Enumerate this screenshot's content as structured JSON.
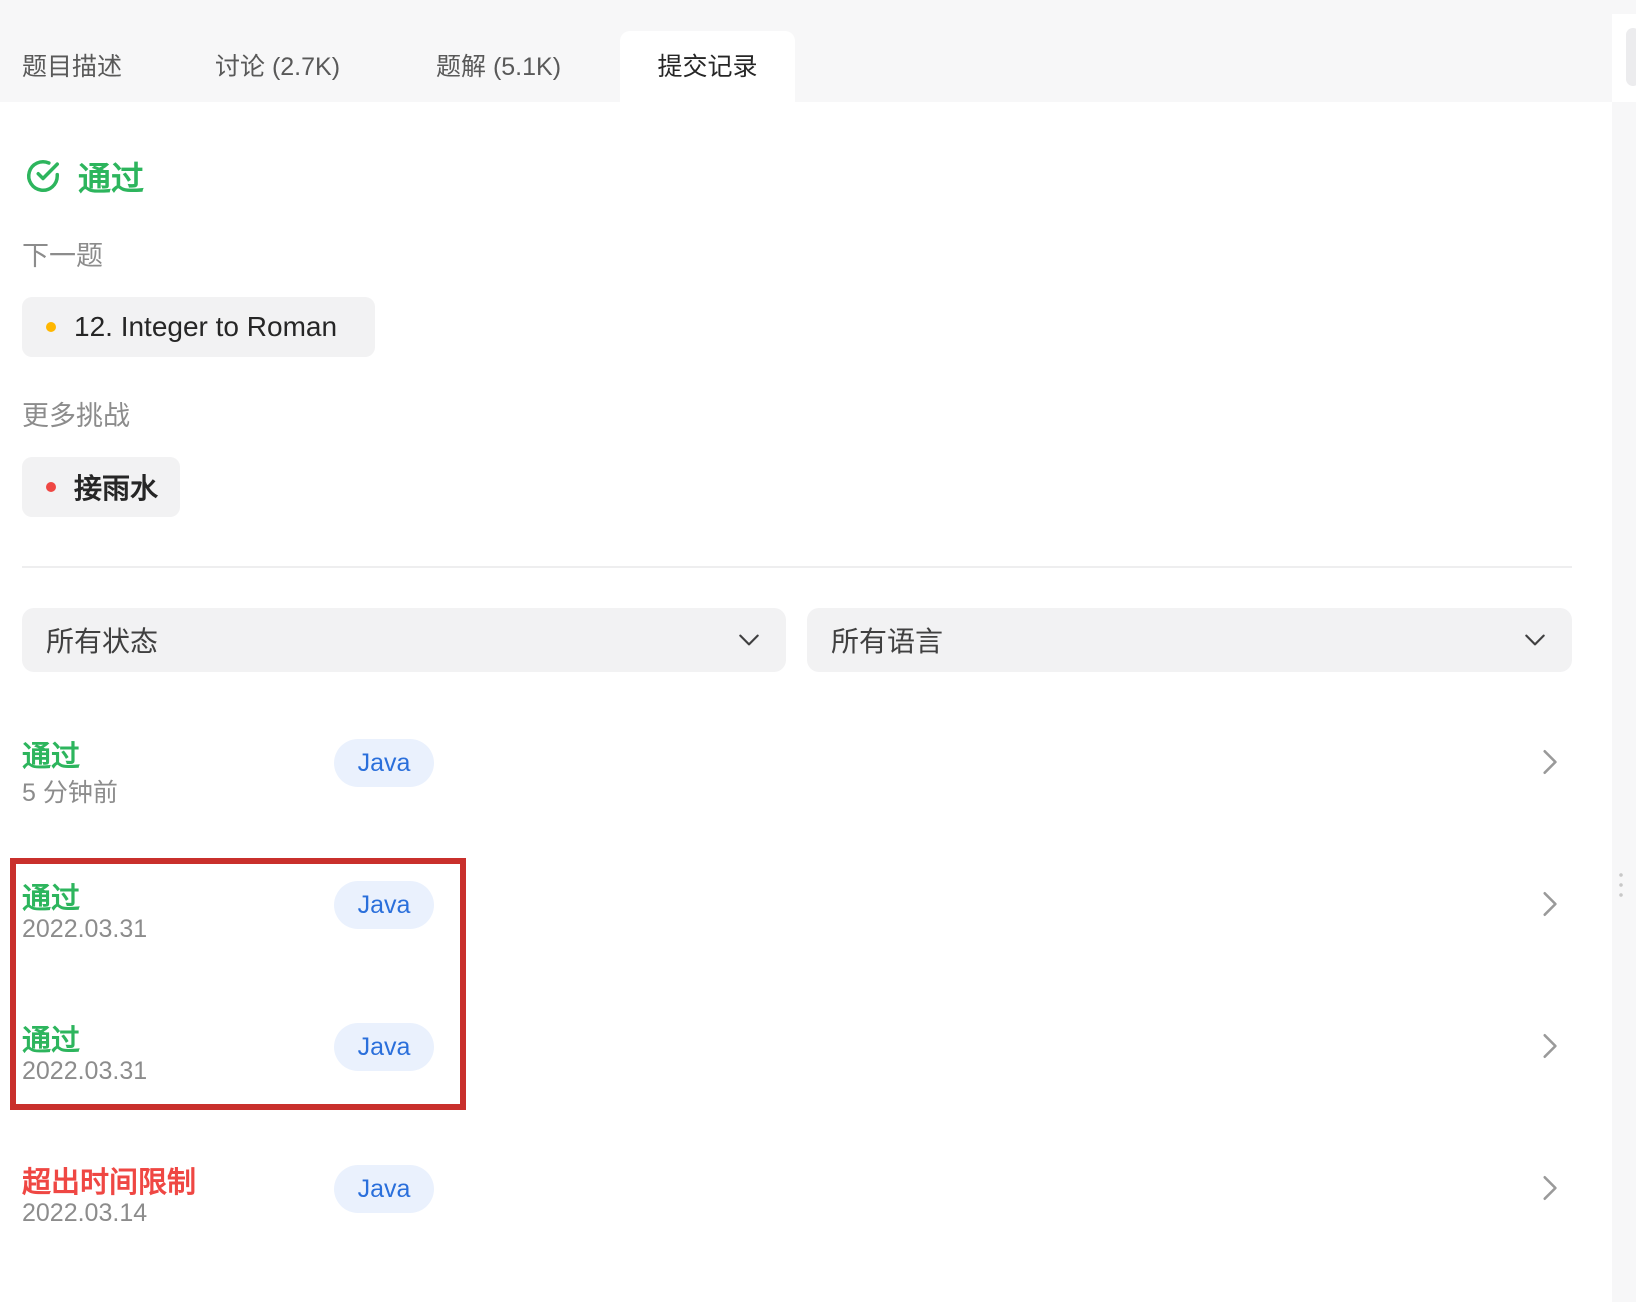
{
  "tabs": [
    {
      "label": "题目描述"
    },
    {
      "label": "讨论 (2.7K)"
    },
    {
      "label": "题解 (5.1K)"
    },
    {
      "label": "提交记录"
    }
  ],
  "status": {
    "label": "通过",
    "color": "#2db55d"
  },
  "next_problem": {
    "heading": "下一题",
    "title": "12. Integer to Roman",
    "difficulty_color": "#ffb700"
  },
  "more_challenges": {
    "heading": "更多挑战",
    "title": "接雨水",
    "difficulty_color": "#ef4743"
  },
  "filters": {
    "status": {
      "value": "所有状态"
    },
    "language": {
      "value": "所有语言"
    }
  },
  "submissions": [
    {
      "status": "通过",
      "time": "5 分钟前",
      "lang": "Java",
      "status_color": "#2db55d"
    },
    {
      "status": "通过",
      "time": "2022.03.31",
      "lang": "Java",
      "status_color": "#2db55d"
    },
    {
      "status": "通过",
      "time": "2022.03.31",
      "lang": "Java",
      "status_color": "#2db55d"
    },
    {
      "status": "超出时间限制",
      "time": "2022.03.14",
      "lang": "Java",
      "status_color": "#ef4743"
    }
  ]
}
